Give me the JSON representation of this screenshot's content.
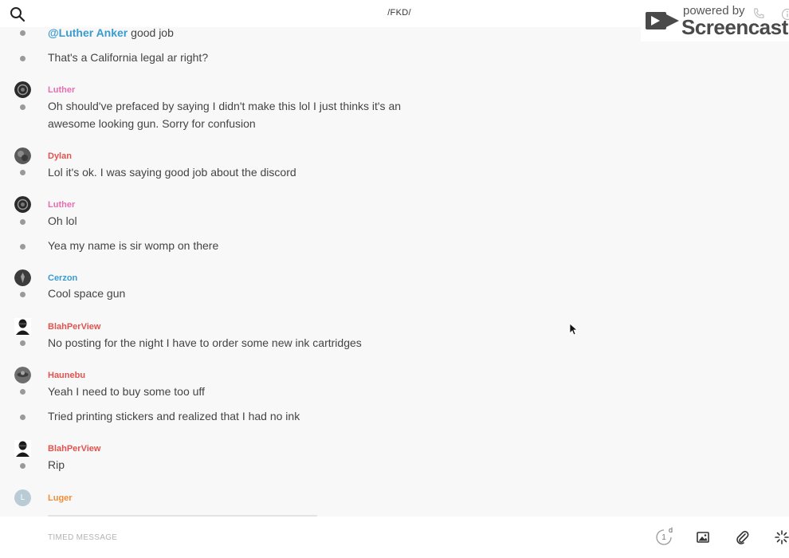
{
  "header": {
    "title": "/FKD/",
    "search_icon": "search-icon"
  },
  "watermark": {
    "powered_by": "powered by",
    "brand": "Screencastify"
  },
  "messages": [
    {
      "text_parts": {
        "mention": "@Luther Anker",
        "rest": " good job"
      }
    },
    {
      "text": "That's a California legal ar right?"
    },
    {
      "sender": "Luther",
      "sender_color": "#e56fb1",
      "text": "Oh should've prefaced by saying I didn't make this lol I just thinks it's an",
      "text2": "awesome looking gun. Sorry for confusion"
    },
    {
      "sender": "Dylan",
      "sender_color": "#e0534e",
      "text": "Lol it's ok. I was saying good job about the discord"
    },
    {
      "sender": "Luther",
      "sender_color": "#e56fb1",
      "text": "Oh lol"
    },
    {
      "text": "Yea my name is sir womp on there"
    },
    {
      "sender": "Cerzon",
      "sender_color": "#3a9bd0",
      "text": "Cool space gun"
    },
    {
      "sender": "BlahPerView",
      "sender_color": "#e0534e",
      "text": "No posting for the night I have to order some new ink cartridges"
    },
    {
      "sender": "Haunebu",
      "sender_color": "#e0534e",
      "text": "Yeah I need to buy some too uff"
    },
    {
      "text": "Tried printing stickers and realized that I had no ink"
    },
    {
      "sender": "BlahPerView",
      "sender_color": "#e0534e",
      "text": "Rip"
    },
    {
      "sender": "Luger",
      "sender_color": "#ef8e3a",
      "avatar_letter": "L"
    }
  ],
  "composer": {
    "placeholder": "TIMED MESSAGE",
    "timer_count": "1",
    "timer_unit": "d"
  },
  "colors": {
    "mention": "#3a9bd0",
    "background": "#f8f8f8"
  }
}
